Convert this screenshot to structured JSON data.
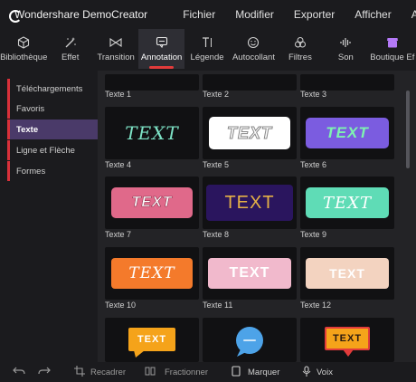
{
  "app": {
    "title": "Wondershare DemoCreator",
    "logo_icon": "democreator-logo-icon",
    "logo_color": "#8e3df5"
  },
  "menu": [
    "Fichier",
    "Modifier",
    "Exporter",
    "Afficher",
    "Aide"
  ],
  "toolbar": {
    "items": [
      {
        "label": "Bibliothèque",
        "icon": "cube-icon"
      },
      {
        "label": "Effet",
        "icon": "magic-wand-icon"
      },
      {
        "label": "Transition",
        "icon": "transition-icon"
      },
      {
        "label": "Annotation",
        "icon": "speech-bubble-icon"
      },
      {
        "label": "Légende",
        "icon": "text-cursor-icon"
      },
      {
        "label": "Autocollant",
        "icon": "smiley-icon"
      },
      {
        "label": "Filtres",
        "icon": "filters-icon"
      },
      {
        "label": "Son",
        "icon": "sound-wave-icon"
      },
      {
        "label": "Boutique Ef",
        "icon": "shop-icon"
      }
    ],
    "active": "Annotation",
    "accent": "#e23b3b"
  },
  "sidebar": {
    "categories": [
      "Téléchargements",
      "Favoris",
      "Texte",
      "Ligne et Flèche",
      "Formes"
    ],
    "active": "Texte",
    "active_color": "#4a3a69"
  },
  "grid": {
    "top_captions": [
      "Texte 1",
      "Texte 2",
      "Texte 3"
    ],
    "items": [
      {
        "caption": "Texte 4",
        "tag_text": "TEXT"
      },
      {
        "caption": "Texte 5",
        "tag_text": "TEXT"
      },
      {
        "caption": "Texte 6",
        "tag_text": "TEXT"
      },
      {
        "caption": "Texte 7",
        "tag_text": "TEXT"
      },
      {
        "caption": "Texte 8",
        "tag_text": "TEXT"
      },
      {
        "caption": "Texte 9",
        "tag_text": "TEXT"
      },
      {
        "caption": "Texte 10",
        "tag_text": "TEXT"
      },
      {
        "caption": "Texte 11",
        "tag_text": "TEXT"
      },
      {
        "caption": "Texte 12",
        "tag_text": "TEXT"
      },
      {
        "caption": "",
        "tag_text": "TEXT"
      },
      {
        "caption": "",
        "tag_text": ""
      },
      {
        "caption": "",
        "tag_text": "TEXT"
      }
    ]
  },
  "bottombar": {
    "undo_icon": "undo-icon",
    "redo_icon": "redo-icon",
    "crop_label": "Recadrer",
    "split_label": "Fractionner",
    "mark_label": "Marquer",
    "voice_label": "Voix"
  }
}
